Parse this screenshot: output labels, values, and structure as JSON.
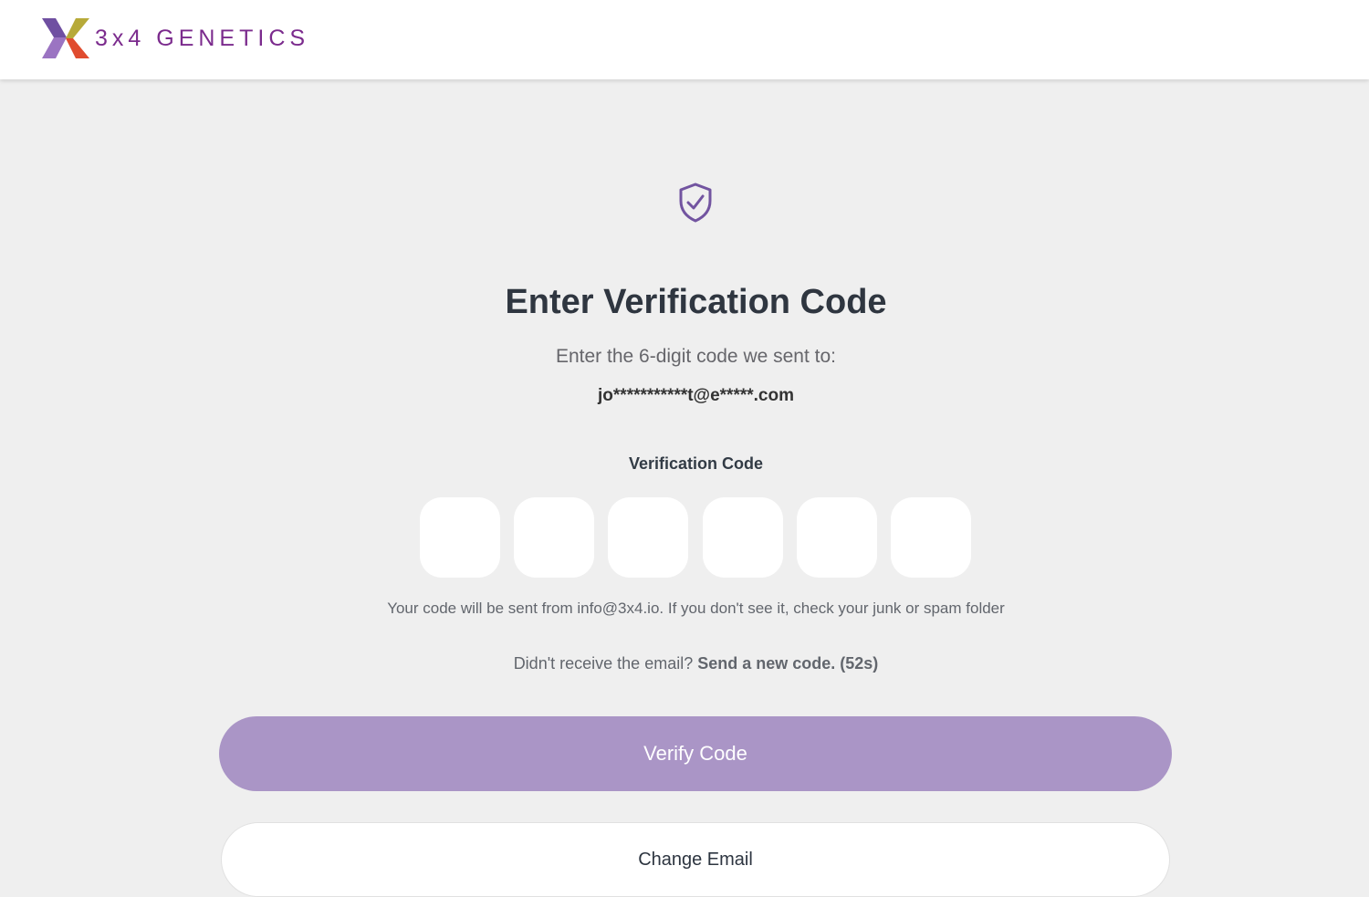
{
  "header": {
    "brand_name": "3x4 GENETICS",
    "brand_color": "#7b2b8d"
  },
  "main": {
    "icon": "shield-check-icon",
    "title": "Enter Verification Code",
    "subtitle": "Enter the 6-digit code we sent to:",
    "masked_email": "jo***********t@e*****.com",
    "code_label": "Verification Code",
    "code_digits": [
      "",
      "",
      "",
      "",
      "",
      ""
    ],
    "hint": "Your code will be sent from info@3x4.io. If you don't see it, check your junk or spam folder",
    "resend_prompt": "Didn't receive the email? ",
    "resend_link": "Send a new code. (52s)",
    "verify_button": "Verify Code",
    "change_email_button": "Change Email"
  },
  "colors": {
    "page_background": "#efefef",
    "accent": "#aa95c6",
    "shield_icon": "#7254a0",
    "title_text": "#2f3640"
  }
}
